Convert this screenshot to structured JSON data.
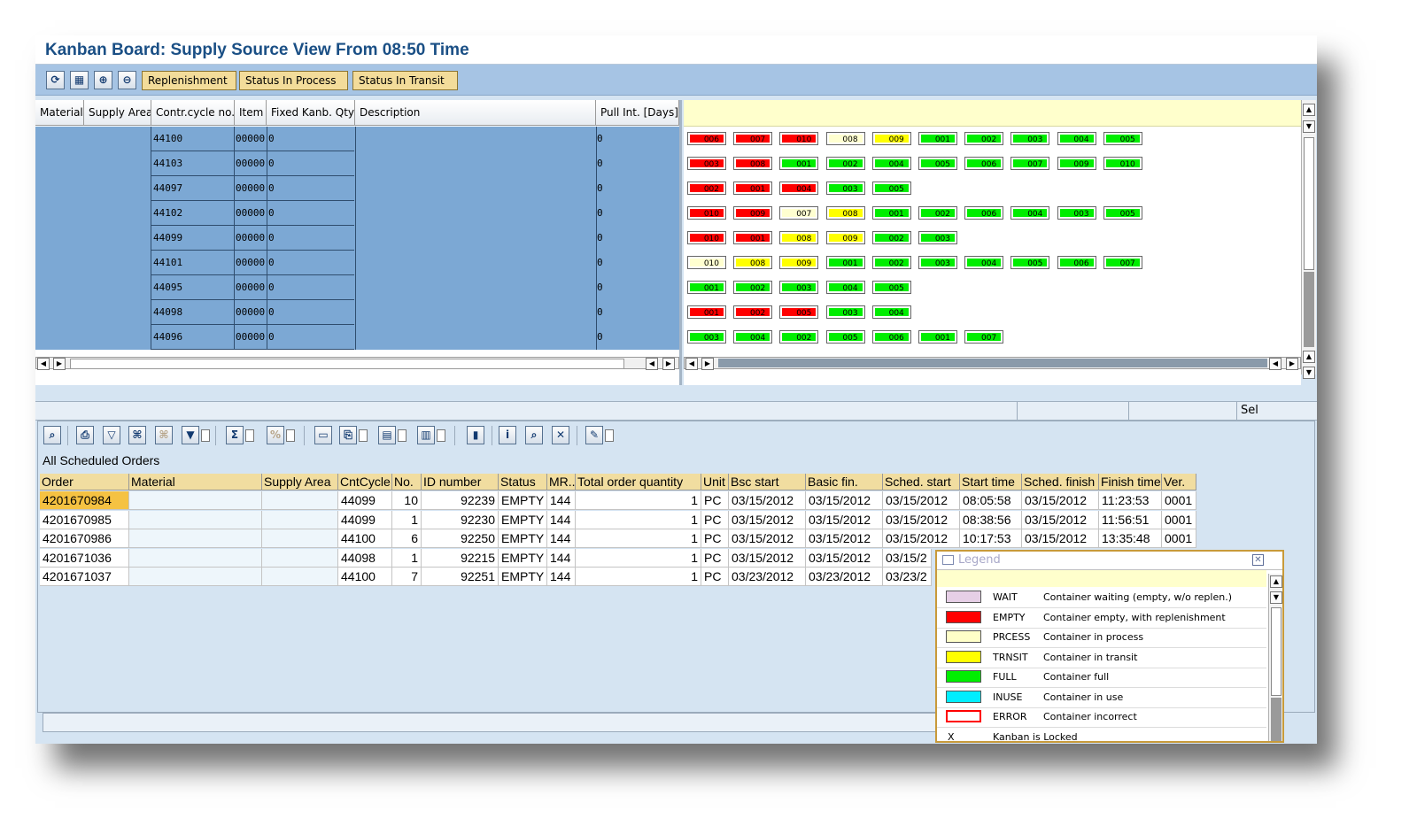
{
  "window": {
    "title": "Kanban Board: Supply Source View From 08:50 Time"
  },
  "toolbar": {
    "icons": [
      "refresh-icon",
      "layout-icon",
      "zoom-in-icon",
      "zoom-out-icon"
    ],
    "buttons": [
      "Replenishment",
      "Status In Process",
      "Status In Transit"
    ]
  },
  "left_table": {
    "columns": [
      "Material",
      "Supply Area",
      "Contr.cycle no.",
      "Item",
      "Fixed Kanb. Qty",
      "Description",
      "Pull Int. [Days]"
    ],
    "rows": [
      {
        "cycle": "44100",
        "item": "00000",
        "qty": "0",
        "pull": "0"
      },
      {
        "cycle": "44103",
        "item": "00000",
        "qty": "0",
        "pull": "0"
      },
      {
        "cycle": "44097",
        "item": "00000",
        "qty": "0",
        "pull": "0"
      },
      {
        "cycle": "44102",
        "item": "00000",
        "qty": "0",
        "pull": "0"
      },
      {
        "cycle": "44099",
        "item": "00000",
        "qty": "0",
        "pull": "0"
      },
      {
        "cycle": "44101",
        "item": "00000",
        "qty": "0",
        "pull": "0"
      },
      {
        "cycle": "44095",
        "item": "00000",
        "qty": "0",
        "pull": "0"
      },
      {
        "cycle": "44098",
        "item": "00000",
        "qty": "0",
        "pull": "0"
      },
      {
        "cycle": "44096",
        "item": "00000",
        "qty": "0",
        "pull": "0"
      }
    ]
  },
  "colors": {
    "red": "#ff0000",
    "green": "#00ee00",
    "yellow": "#ffff00",
    "process": "#ffffd0",
    "wait": "#e6cfe6",
    "inuse": "#00eeff"
  },
  "kanban_rows": [
    [
      [
        "006",
        "red"
      ],
      [
        "007",
        "red"
      ],
      [
        "010",
        "red"
      ],
      [
        "008",
        "process"
      ],
      [
        "009",
        "yellow"
      ],
      [
        "001",
        "green"
      ],
      [
        "002",
        "green"
      ],
      [
        "003",
        "green"
      ],
      [
        "004",
        "green"
      ],
      [
        "005",
        "green"
      ]
    ],
    [
      [
        "003",
        "red"
      ],
      [
        "008",
        "red"
      ],
      [
        "001",
        "green"
      ],
      [
        "002",
        "green"
      ],
      [
        "004",
        "green"
      ],
      [
        "005",
        "green"
      ],
      [
        "006",
        "green"
      ],
      [
        "007",
        "green"
      ],
      [
        "009",
        "green"
      ],
      [
        "010",
        "green"
      ]
    ],
    [
      [
        "002",
        "red"
      ],
      [
        "001",
        "red"
      ],
      [
        "004",
        "red"
      ],
      [
        "003",
        "green"
      ],
      [
        "005",
        "green"
      ]
    ],
    [
      [
        "010",
        "red"
      ],
      [
        "009",
        "red"
      ],
      [
        "007",
        "process"
      ],
      [
        "008",
        "yellow"
      ],
      [
        "001",
        "green"
      ],
      [
        "002",
        "green"
      ],
      [
        "006",
        "green"
      ],
      [
        "004",
        "green"
      ],
      [
        "003",
        "green"
      ],
      [
        "005",
        "green"
      ]
    ],
    [
      [
        "010",
        "red"
      ],
      [
        "001",
        "red"
      ],
      [
        "008",
        "yellow"
      ],
      [
        "009",
        "yellow"
      ],
      [
        "002",
        "green"
      ],
      [
        "003",
        "green"
      ]
    ],
    [
      [
        "010",
        "process"
      ],
      [
        "008",
        "yellow"
      ],
      [
        "009",
        "yellow"
      ],
      [
        "001",
        "green"
      ],
      [
        "002",
        "green"
      ],
      [
        "003",
        "green"
      ],
      [
        "004",
        "green"
      ],
      [
        "005",
        "green"
      ],
      [
        "006",
        "green"
      ],
      [
        "007",
        "green"
      ]
    ],
    [
      [
        "001",
        "green"
      ],
      [
        "002",
        "green"
      ],
      [
        "003",
        "green"
      ],
      [
        "004",
        "green"
      ],
      [
        "005",
        "green"
      ]
    ],
    [
      [
        "001",
        "red"
      ],
      [
        "002",
        "red"
      ],
      [
        "005",
        "red"
      ],
      [
        "003",
        "green"
      ],
      [
        "004",
        "green"
      ]
    ],
    [
      [
        "003",
        "green"
      ],
      [
        "004",
        "green"
      ],
      [
        "002",
        "green"
      ],
      [
        "005",
        "green"
      ],
      [
        "006",
        "green"
      ],
      [
        "001",
        "green"
      ],
      [
        "007",
        "green"
      ]
    ]
  ],
  "status_bar": {
    "sel": "Sel"
  },
  "bottom_toolbar": {
    "icons": [
      "details-icon",
      "print-icon",
      "filter-icon",
      "find-icon",
      "find-next-icon",
      "set-filter-icon",
      "sum-icon",
      "subtotal-icon",
      "print-preview-icon",
      "export-icon",
      "spreadsheet-icon",
      "layout-icon",
      "graphic-icon",
      "info-icon",
      "zoom-icon",
      "close-icon",
      "edit-icon"
    ]
  },
  "grid": {
    "title": "All Scheduled Orders",
    "columns": [
      "Order",
      "Material",
      "Supply Area",
      "CntCycle",
      "No.",
      "ID number",
      "Status",
      "MR..",
      "Total order quantity",
      "Unit",
      "Bsc start",
      "Basic fin.",
      "Sched. start",
      "Start time",
      "Sched. finish",
      "Finish time",
      "Ver."
    ],
    "rows": [
      [
        "4201670984",
        "",
        "",
        "44099",
        "10",
        "92239",
        "EMPTY",
        "144",
        "1",
        "PC",
        "03/15/2012",
        "03/15/2012",
        "03/15/2012",
        "08:05:58",
        "03/15/2012",
        "11:23:53",
        "0001"
      ],
      [
        "4201670985",
        "",
        "",
        "44099",
        "1",
        "92230",
        "EMPTY",
        "144",
        "1",
        "PC",
        "03/15/2012",
        "03/15/2012",
        "03/15/2012",
        "08:38:56",
        "03/15/2012",
        "11:56:51",
        "0001"
      ],
      [
        "4201670986",
        "",
        "",
        "44100",
        "6",
        "92250",
        "EMPTY",
        "144",
        "1",
        "PC",
        "03/15/2012",
        "03/15/2012",
        "03/15/2012",
        "10:17:53",
        "03/15/2012",
        "13:35:48",
        "0001"
      ],
      [
        "4201671036",
        "",
        "",
        "44098",
        "1",
        "92215",
        "EMPTY",
        "144",
        "1",
        "PC",
        "03/15/2012",
        "03/15/2012",
        "03/15/2",
        "",
        "",
        "",
        ""
      ],
      [
        "4201671037",
        "",
        "",
        "44100",
        "7",
        "92251",
        "EMPTY",
        "144",
        "1",
        "PC",
        "03/23/2012",
        "03/23/2012",
        "03/23/2",
        "",
        "",
        "",
        ""
      ]
    ]
  },
  "legend": {
    "title": "Legend",
    "items": [
      {
        "code": "WAIT",
        "desc": "Container waiting (empty, w/o replen.)",
        "color": "#e6cfe6",
        "border": "#555555"
      },
      {
        "code": "EMPTY",
        "desc": "Container empty, with replenishment",
        "color": "#ff0000",
        "border": "#555555"
      },
      {
        "code": "PRCESS",
        "desc": "Container in process",
        "color": "#ffffc8",
        "border": "#555555"
      },
      {
        "code": "TRNSIT",
        "desc": "Container in transit",
        "color": "#ffff00",
        "border": "#555555"
      },
      {
        "code": "FULL",
        "desc": "Container full",
        "color": "#00ee00",
        "border": "#555555"
      },
      {
        "code": "INUSE",
        "desc": "Container in use",
        "color": "#00eeff",
        "border": "#555555"
      },
      {
        "code": "ERROR",
        "desc": "Container incorrect",
        "color": "#ffffff",
        "border": "#ff0000"
      },
      {
        "code": "X",
        "desc": "Kanban is Locked",
        "color": "",
        "border": ""
      }
    ]
  }
}
